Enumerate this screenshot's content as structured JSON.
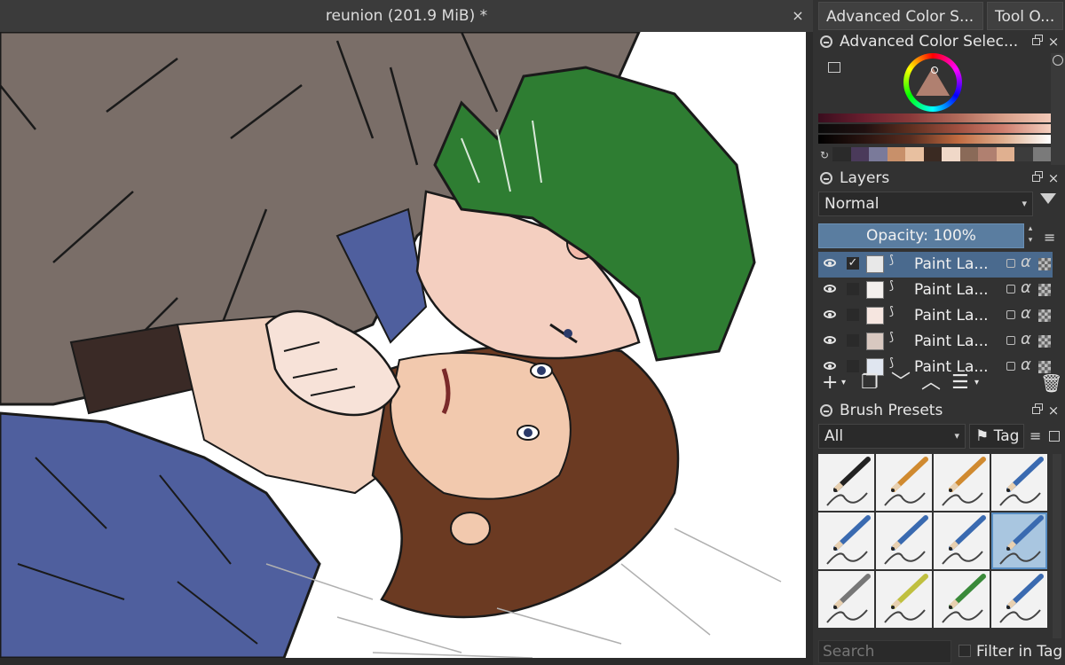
{
  "document": {
    "title": "reunion (201.9 MiB) *",
    "close_glyph": "×"
  },
  "dock_tabs": [
    "Advanced Color S...",
    "Tool O..."
  ],
  "color_panel": {
    "title": "Advanced Color Selec...",
    "close_glyph": "×"
  },
  "layers_panel": {
    "title": "Layers",
    "close_glyph": "×",
    "blend_mode": "Normal",
    "opacity_label": "Opacity:  100%",
    "layers": [
      {
        "name": "Paint La...",
        "selected": true,
        "checked": "✓"
      },
      {
        "name": "Paint La...",
        "selected": false,
        "checked": ""
      },
      {
        "name": "Paint La...",
        "selected": false,
        "checked": ""
      },
      {
        "name": "Paint La...",
        "selected": false,
        "checked": ""
      },
      {
        "name": "Paint La...",
        "selected": false,
        "checked": ""
      }
    ],
    "tools": {
      "add": "+",
      "duplicate": "❐",
      "down": "﹀",
      "up": "︿",
      "properties": "☰",
      "delete": "🗑"
    }
  },
  "brush_panel": {
    "title": "Brush Presets",
    "close_glyph": "×",
    "tag_select": "All",
    "tag_button": "Tag",
    "search_placeholder": "Search",
    "filter_in_tag": "Filter in Tag"
  },
  "colors": {
    "accent": "#5a7da0",
    "selected_row": "#4a6a8e",
    "hair_green": "#2e7d32",
    "hair_brown": "#6b3a22",
    "shirt_blue": "#4f5f9e",
    "coat_gray": "#7a6e68"
  }
}
